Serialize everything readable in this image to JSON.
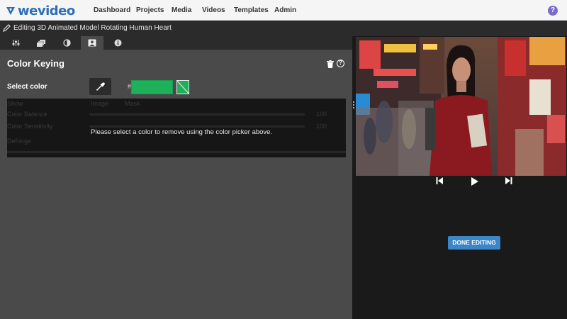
{
  "app": {
    "logo_text": "wevideo",
    "brand_color": "#2d6fb7"
  },
  "nav": {
    "items": [
      {
        "label": "Dashboard"
      },
      {
        "label": "Projects"
      },
      {
        "label": "Media"
      },
      {
        "label": "Videos"
      },
      {
        "label": "Templates"
      },
      {
        "label": "Admin"
      }
    ],
    "help_label": "?"
  },
  "editor": {
    "title": "Editing 3D Animated Model Rotating Human Heart"
  },
  "tabs": [
    {
      "icon": "sliders-icon",
      "active": false
    },
    {
      "icon": "layers-icon",
      "active": false
    },
    {
      "icon": "contrast-icon",
      "active": false
    },
    {
      "icon": "portrait-icon",
      "active": true
    },
    {
      "icon": "info-icon",
      "active": false
    }
  ],
  "color_keying": {
    "title": "Color Keying",
    "select_color_label": "Select color",
    "hash": "#",
    "color_value": "",
    "key_color": "#1fb15a",
    "ghost": {
      "show_label": "Show",
      "option_image": "Image",
      "option_mask": "Mask",
      "balance_label": "Color Balance",
      "balance_value": "100",
      "sensitivity_label": "Color Sensitivity",
      "sensitivity_value": "100",
      "defringe_label": "Defringe"
    },
    "message": "Please select a color to remove using the color picker above."
  },
  "player": {
    "done_label": "DONE EDITING",
    "accent": "#3a86c9"
  }
}
